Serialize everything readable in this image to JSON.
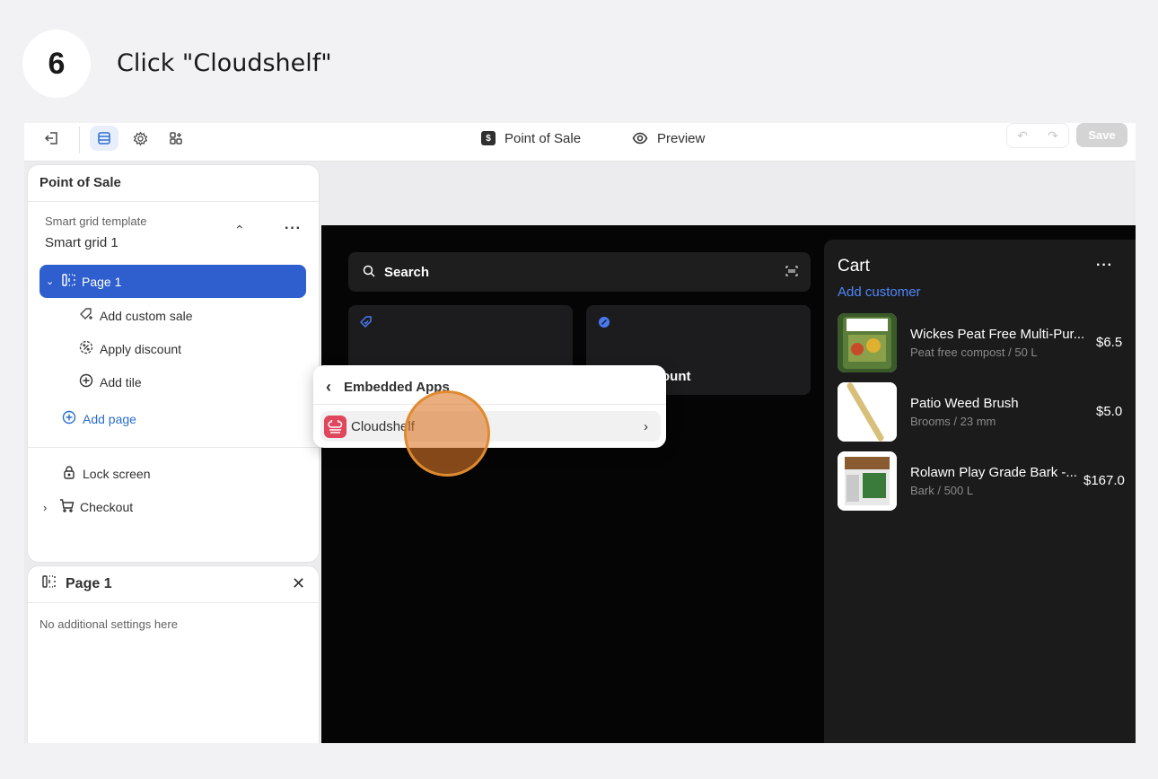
{
  "step": {
    "number": "6",
    "instruction": "Click \"Cloudshelf\""
  },
  "toolbar": {
    "title": "Point of Sale",
    "preview_label": "Preview",
    "save_label": "Save",
    "icons": [
      "exit-icon",
      "grid-icon",
      "gear-icon",
      "apps-icon",
      "undo-icon",
      "redo-icon"
    ]
  },
  "sidebar": {
    "title": "Point of Sale",
    "template_label": "Smart grid template",
    "template_value": "Smart grid 1",
    "page_label": "Page 1",
    "items": [
      {
        "label": "Add custom sale",
        "icon": "tag-plus-icon"
      },
      {
        "label": "Apply discount",
        "icon": "discount-icon"
      },
      {
        "label": "Add tile",
        "icon": "plus-circle-icon"
      }
    ],
    "add_page": "Add page",
    "lock_screen": "Lock screen",
    "checkout": "Checkout"
  },
  "settings_panel": {
    "title": "Page 1",
    "note": "No additional settings here"
  },
  "canvas": {
    "search_label": "Search",
    "tile2_label": "ount"
  },
  "cart": {
    "title": "Cart",
    "add_customer": "Add customer",
    "items": [
      {
        "name": "Wickes Peat Free Multi-Pur...",
        "sub": "Peat free compost / 50 L",
        "price": "$6.5"
      },
      {
        "name": "Patio Weed Brush",
        "sub": "Brooms / 23 mm",
        "price": "$5.0"
      },
      {
        "name": "Rolawn Play Grade Bark -...",
        "sub": "Bark / 500 L",
        "price": "$167.0"
      }
    ]
  },
  "popup": {
    "title": "Embedded Apps",
    "app_name": "Cloudshelf"
  },
  "colors": {
    "accent": "#2f5fce",
    "link": "#2c6ecb",
    "click_highlight": "#e08a30",
    "app_icon": "#e0465c"
  }
}
